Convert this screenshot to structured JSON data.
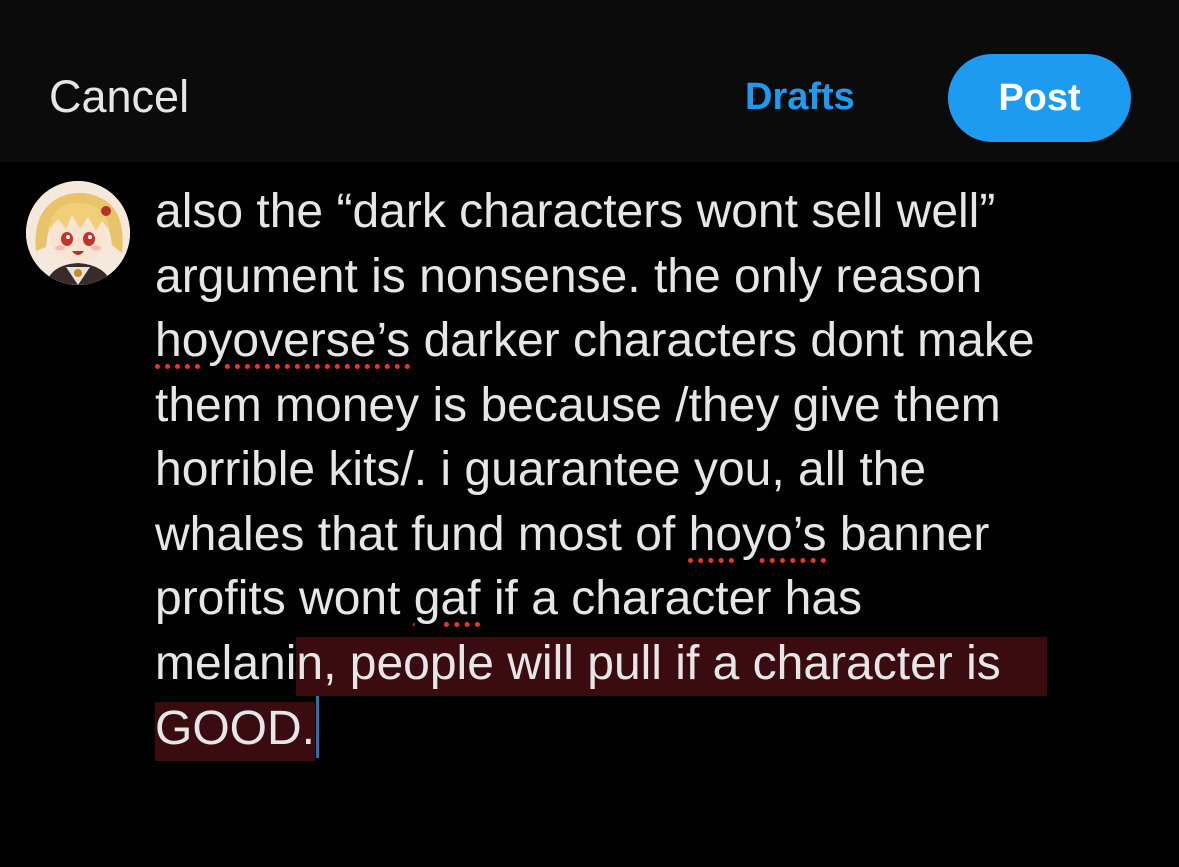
{
  "header": {
    "cancel_label": "Cancel",
    "drafts_label": "Drafts",
    "post_label": "Post"
  },
  "avatar": {
    "icon": "anime-character-avatar"
  },
  "composer": {
    "line_1": "also the “dark characters wont sell well”",
    "line_2": "argument is nonsense. the only reason",
    "line_3_word_1": "hoyoverse’s",
    "line_3_rest": " darker characters dont make",
    "line_4": "them money is because /they give them",
    "line_5": "horrible kits/. i guarantee you, all the",
    "line_6_start": "whales that fund most of ",
    "line_6_word": "hoyo’s",
    "line_6_end": " banner",
    "line_7_start": "profits wont ",
    "line_7_word": "gaf",
    "line_7_end": " if a character has",
    "line_8_start": "melani",
    "line_8_selected": "n, people will pull if a character is",
    "line_9_selected": "GOOD."
  },
  "colors": {
    "accent": "#1d9bf0",
    "background": "#000000",
    "topbar": "#0b0b0b",
    "text": "#e6e6e6",
    "selection": "#3a0c0f",
    "spellcheck": "#e8362c"
  }
}
